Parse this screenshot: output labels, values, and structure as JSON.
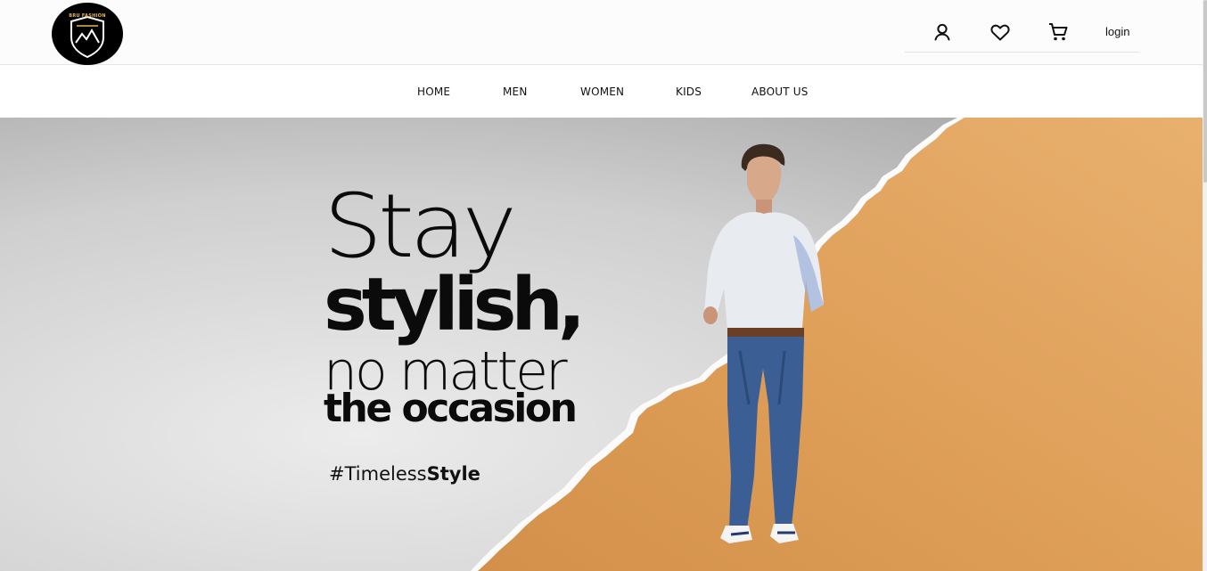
{
  "brand": {
    "logo_text": "BRU FASHION"
  },
  "header": {
    "icons": [
      "user-icon",
      "heart-icon",
      "cart-icon"
    ],
    "login_label": "login"
  },
  "nav": {
    "items": [
      {
        "label": "HOME"
      },
      {
        "label": "MEN"
      },
      {
        "label": "WOMEN"
      },
      {
        "label": "KIDS"
      },
      {
        "label": "ABOUT US"
      }
    ]
  },
  "hero": {
    "line1": "Stay",
    "line2": "stylish,",
    "line3": "no matter",
    "line4": "the occasion",
    "hashtag_light": "#Timeless",
    "hashtag_bold": "Style",
    "colors": {
      "grey_left": "#c4c4c4",
      "orange": "#e0a25c",
      "orange_dark": "#d4914a"
    }
  }
}
